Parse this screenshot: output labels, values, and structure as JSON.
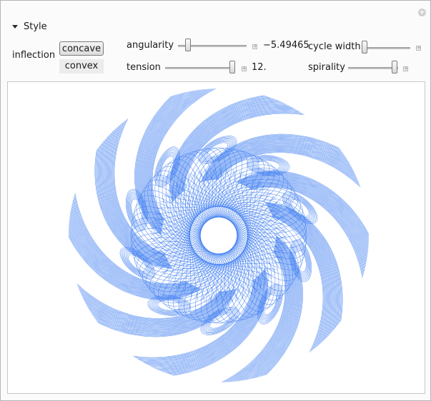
{
  "section": {
    "title": "Style"
  },
  "inflection": {
    "label": "inflection",
    "options": [
      "concave",
      "convex"
    ],
    "selected": "concave"
  },
  "controls": {
    "angularity": {
      "label": "angularity",
      "value_text": "−5.49465",
      "position": 0.12
    },
    "tension": {
      "label": "tension",
      "value_text": "12.",
      "position": 0.97
    },
    "cycle_width": {
      "label": "cycle width",
      "position": 0.02
    },
    "spirality": {
      "label": "spirality",
      "position": 0.9
    }
  },
  "plot": {
    "stroke_color": "#3b7bf0",
    "arms": 10
  }
}
